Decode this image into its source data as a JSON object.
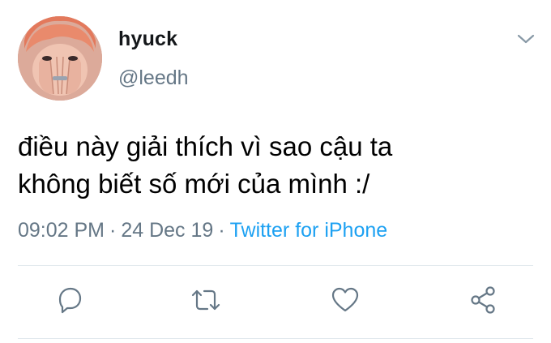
{
  "user": {
    "display_name": "hyuck",
    "handle": "@leedh"
  },
  "tweet": {
    "text_line1": "điều này giải thích vì sao cậu ta",
    "text_line2": "không biết số mới của mình :/",
    "time": "09:02 PM",
    "date": "24 Dec 19",
    "separator": "·",
    "source": "Twitter for iPhone"
  },
  "actions": [
    "reply-icon",
    "retweet-icon",
    "like-icon",
    "share-icon"
  ],
  "colors": {
    "text": "#14171a",
    "secondary": "#657786",
    "link": "#1da1f2",
    "divider": "#e1e8ed"
  }
}
